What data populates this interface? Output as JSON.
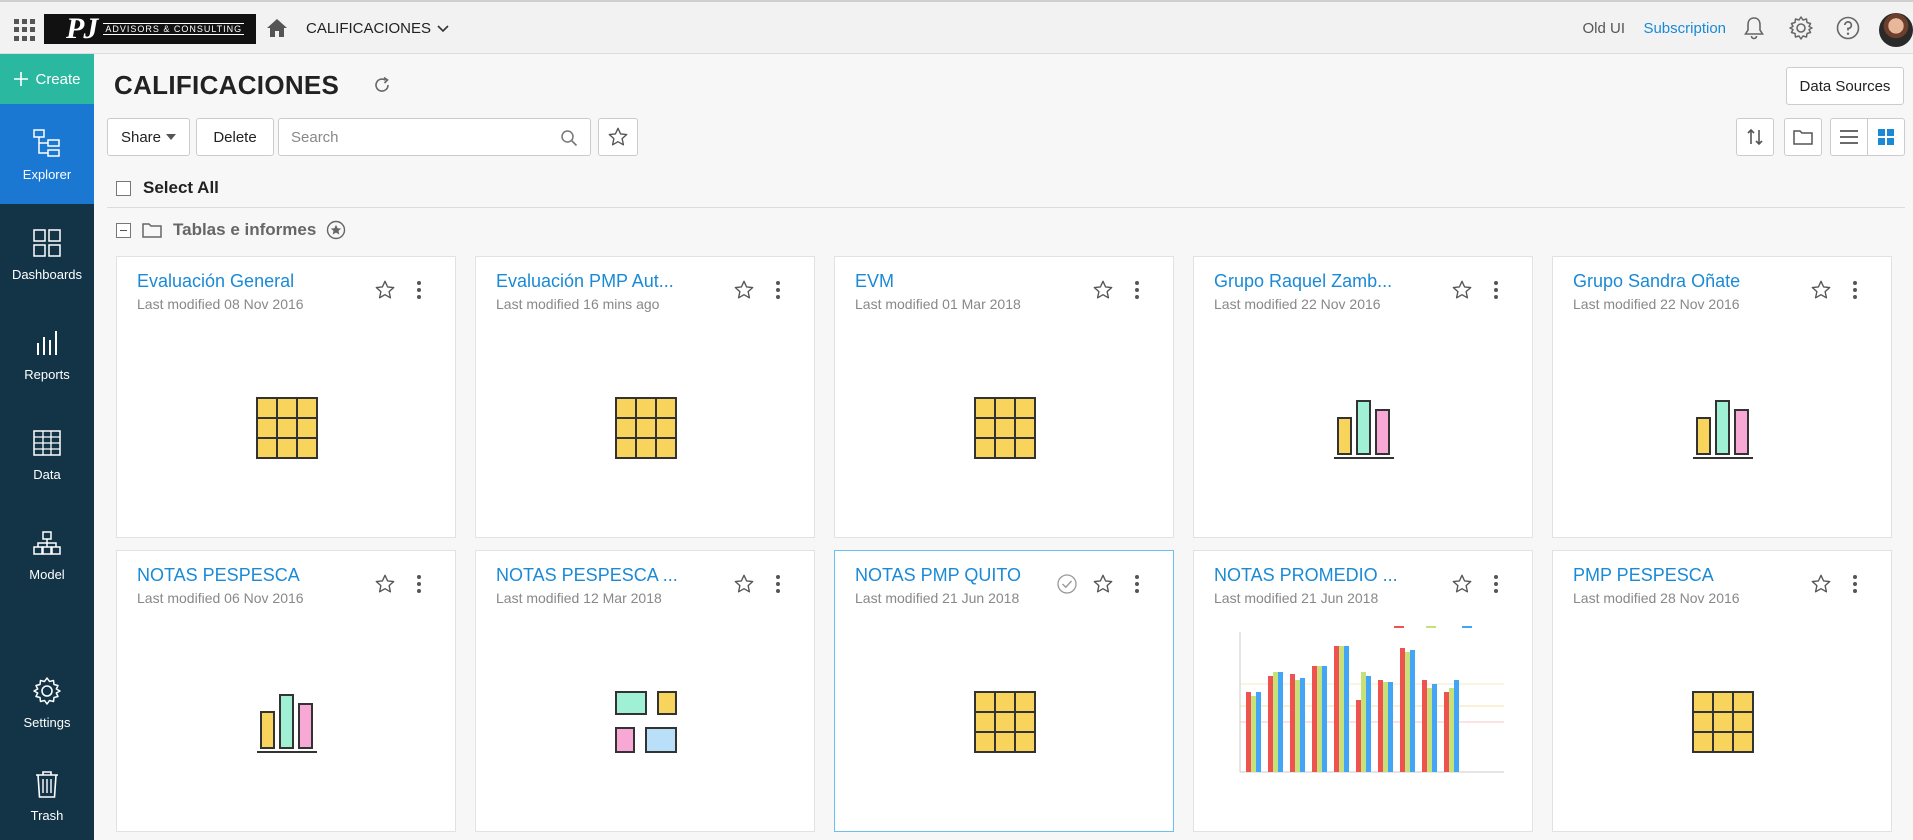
{
  "header": {
    "logo_text": "PJ",
    "logo_subtext": "ADVISORS & CONSULTING",
    "breadcrumb": "CALIFICACIONES",
    "old_ui": "Old UI",
    "subscription": "Subscription"
  },
  "sidebar": {
    "create": "Create",
    "items": [
      {
        "label": "Explorer"
      },
      {
        "label": "Dashboards"
      },
      {
        "label": "Reports"
      },
      {
        "label": "Data"
      },
      {
        "label": "Model"
      },
      {
        "label": "Settings"
      },
      {
        "label": "Trash"
      }
    ]
  },
  "main": {
    "title": "CALIFICACIONES",
    "data_sources": "Data Sources",
    "share": "Share",
    "delete": "Delete",
    "search_placeholder": "Search",
    "select_all": "Select All",
    "folder": "Tablas e informes"
  },
  "cards": [
    {
      "title": "Evaluación General",
      "subtitle": "Last modified 08 Nov 2016",
      "thumb": "table-icon"
    },
    {
      "title": "Evaluación PMP Aut...",
      "subtitle": "Last modified 16 mins ago",
      "thumb": "table-icon"
    },
    {
      "title": "EVM",
      "subtitle": "Last modified 01 Mar 2018",
      "thumb": "table-icon"
    },
    {
      "title": "Grupo Raquel Zamb...",
      "subtitle": "Last modified 22 Nov 2016",
      "thumb": "bar-chart-icon"
    },
    {
      "title": "Grupo Sandra Oñate",
      "subtitle": "Last modified 22 Nov 2016",
      "thumb": "bar-chart-icon"
    },
    {
      "title": "NOTAS PESPESCA",
      "subtitle": "Last modified 06 Nov 2016",
      "thumb": "bar-chart-icon"
    },
    {
      "title": "NOTAS PESPESCA ...",
      "subtitle": "Last modified 12 Mar 2018",
      "thumb": "dashboard-icon"
    },
    {
      "title": "NOTAS PMP QUITO",
      "subtitle": "Last modified 21 Jun 2018",
      "thumb": "table-icon",
      "selected": true
    },
    {
      "title": "NOTAS PROMEDIO ...",
      "subtitle": "Last modified 21 Jun 2018",
      "thumb": "chart-preview"
    },
    {
      "title": "PMP PESPESCA",
      "subtitle": "Last modified 28 Nov 2016",
      "thumb": "table-icon"
    }
  ],
  "colors": {
    "sidebar_bg": "#123446",
    "sidebar_active": "#1a78d2",
    "create_bg": "#2bb8a1",
    "link_blue": "#1a8ad6",
    "icon_yellow": "#f9d45c",
    "icon_green": "#9ff0d4",
    "icon_pink": "#f8a8d4",
    "icon_blue": "#b9e0f8"
  }
}
